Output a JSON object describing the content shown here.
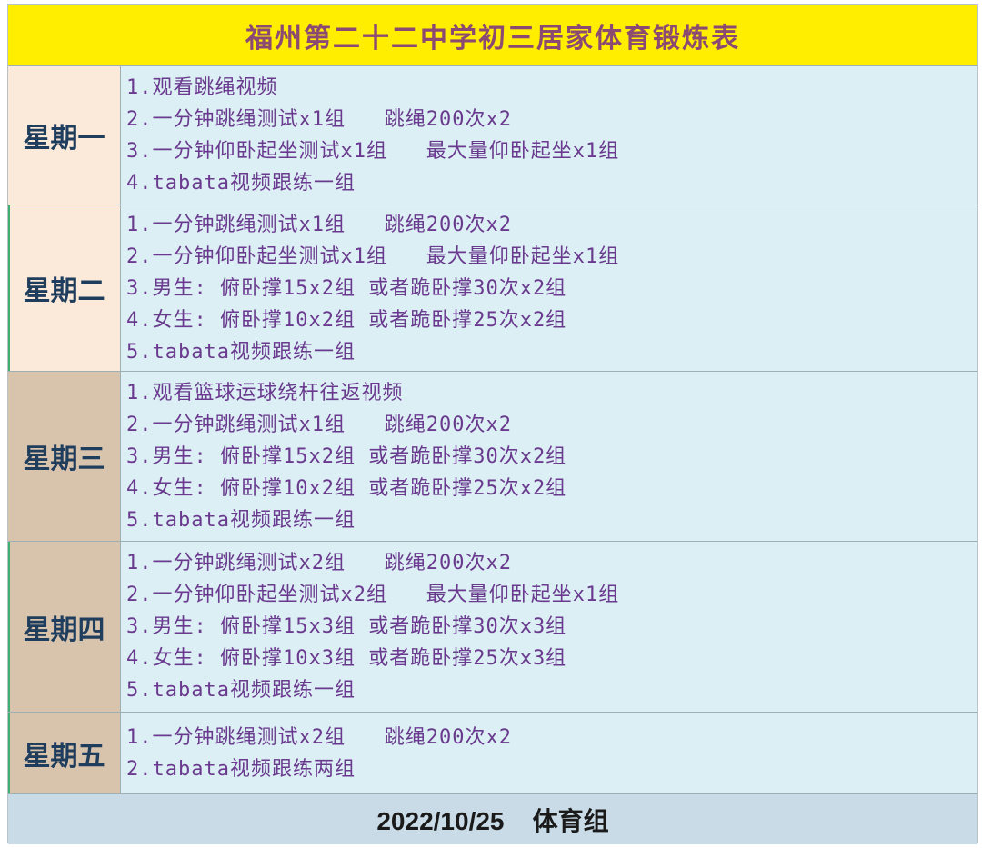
{
  "title": "福州第二十二中学初三居家体育锻炼表",
  "rows": [
    {
      "day": "星期一",
      "tasks": [
        "1.观看跳绳视频",
        "2.一分钟跳绳测试x1组   跳绳200次x2",
        "3.一分钟仰卧起坐测试x1组   最大量仰卧起坐x1组",
        "4.tabata视频跟练一组"
      ]
    },
    {
      "day": "星期二",
      "tasks": [
        "1.一分钟跳绳测试x1组   跳绳200次x2",
        "2.一分钟仰卧起坐测试x1组   最大量仰卧起坐x1组",
        "3.男生: 俯卧撑15x2组 或者跪卧撑30次x2组",
        "4.女生: 俯卧撑10x2组 或者跪卧撑25次x2组",
        "5.tabata视频跟练一组"
      ]
    },
    {
      "day": "星期三",
      "tasks": [
        "1.观看篮球运球绕杆往返视频",
        "2.一分钟跳绳测试x1组   跳绳200次x2",
        "3.男生: 俯卧撑15x2组 或者跪卧撑30次x2组",
        "4.女生: 俯卧撑10x2组 或者跪卧撑25次x2组",
        "5.tabata视频跟练一组"
      ]
    },
    {
      "day": "星期四",
      "tasks": [
        "1.一分钟跳绳测试x2组   跳绳200次x2",
        "2.一分钟仰卧起坐测试x2组   最大量仰卧起坐x1组",
        "3.男生: 俯卧撑15x3组 或者跪卧撑30次x3组",
        "4.女生: 俯卧撑10x3组 或者跪卧撑25次x3组",
        "5.tabata视频跟练一组"
      ]
    },
    {
      "day": "星期五",
      "tasks": [
        "1.一分钟跳绳测试x2组   跳绳200次x2",
        "2.tabata视频跟练两组"
      ]
    }
  ],
  "footer": "2022/10/25    体育组",
  "colors": {
    "title_bg": "#ffee00",
    "title_text": "#8a4a72",
    "day_text": "#1f3d5c",
    "task_text": "#6a3a8e",
    "task_bg": "#dbeff4",
    "footer_bg": "#c8dbe6"
  }
}
